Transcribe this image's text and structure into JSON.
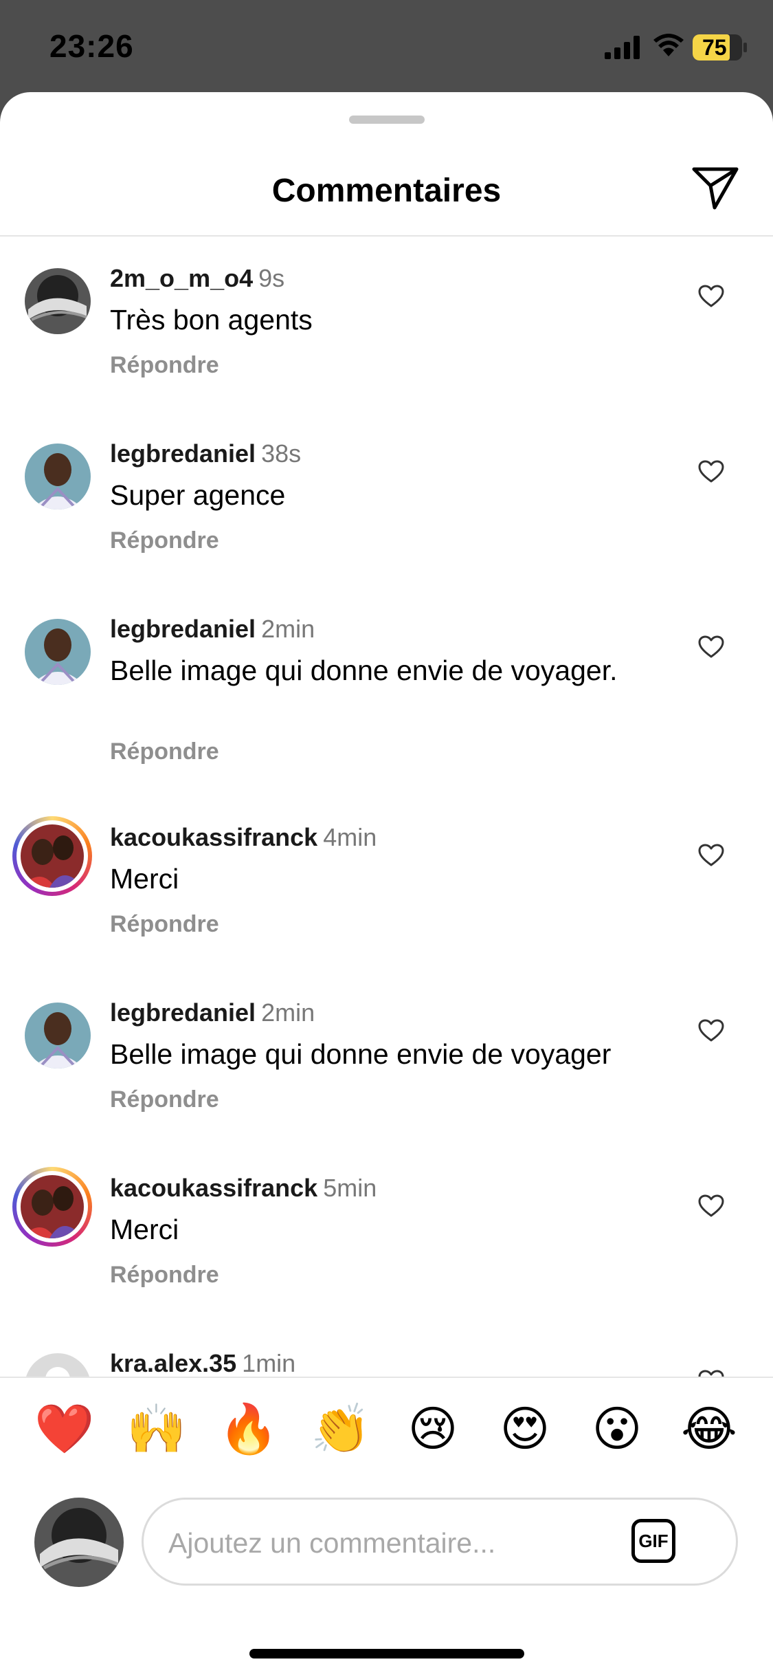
{
  "status": {
    "time": "23:26",
    "battery": "75"
  },
  "header": {
    "title": "Commentaires"
  },
  "comments": [
    {
      "username": "2m_o_m_o4",
      "time": "9s",
      "text": "Très bon agents",
      "reply": "Répondre"
    },
    {
      "username": "legbredaniel",
      "time": "38s",
      "text": "Super agence",
      "reply": "Répondre"
    },
    {
      "username": "legbredaniel",
      "time": "2min",
      "text": "Belle image qui donne envie de voyager.",
      "reply": "Répondre"
    },
    {
      "username": "kacoukassifranck",
      "time": "4min",
      "text": "Merci",
      "reply": "Répondre"
    },
    {
      "username": "legbredaniel",
      "time": "2min",
      "text": "Belle image qui donne envie de voyager",
      "reply": "Répondre"
    },
    {
      "username": "kacoukassifranck",
      "time": "5min",
      "text": "Merci",
      "reply": "Répondre"
    },
    {
      "username": "kra.alex.35",
      "time": "1min"
    }
  ],
  "emojis": [
    "❤️",
    "🙌",
    "🔥",
    "👏",
    "😢",
    "😍",
    "😮",
    "😂"
  ],
  "composer": {
    "placeholder": "Ajoutez un commentaire...",
    "gif_label": "GIF"
  },
  "icons": {
    "send": "paper-plane-icon",
    "like": "heart-outline-icon"
  }
}
